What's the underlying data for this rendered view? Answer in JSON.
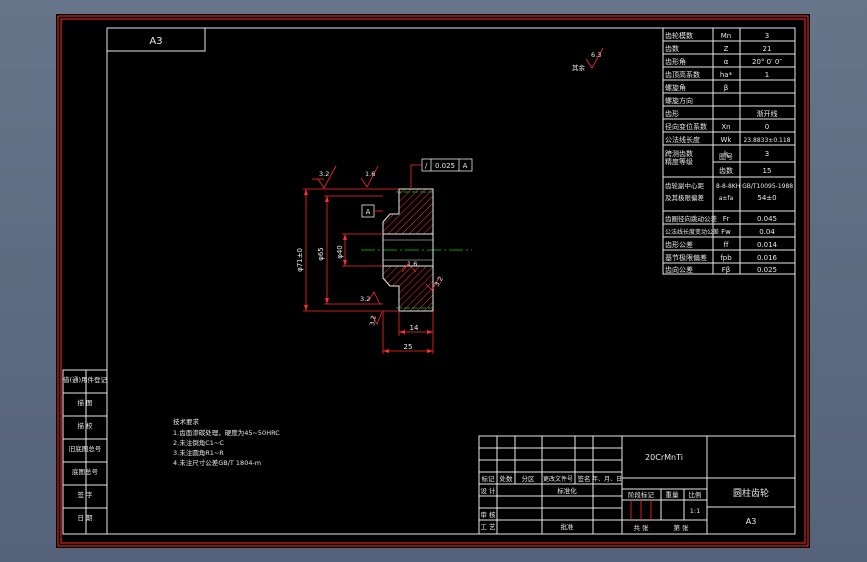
{
  "sheet": {
    "size_label": "A3"
  },
  "params": {
    "rows": [
      {
        "name": "齿轮模数",
        "sym": "Mn",
        "val": "3"
      },
      {
        "name": "齿数",
        "sym": "Z",
        "val": "21"
      },
      {
        "name": "齿形角",
        "sym": "α",
        "val": "20° 0′ 0″"
      },
      {
        "name": "齿顶高系数",
        "sym": "ha*",
        "val": "1"
      },
      {
        "name": "螺旋角",
        "sym": "β",
        "val": ""
      },
      {
        "name": "螺旋方向",
        "sym": "",
        "val": ""
      },
      {
        "name": "齿形",
        "sym": "",
        "val": "渐开线"
      },
      {
        "name": "径向变位系数",
        "sym": "Xn",
        "val": "0"
      },
      {
        "name": "公法线长度",
        "sym": "Wk",
        "val": "23.8833±0.118"
      },
      {
        "name": "跨测齿数",
        "sym": "k",
        "val": "3"
      },
      {
        "name": "精度等级",
        "sym": "",
        "val": ""
      },
      {
        "name": "齿轮副中心距",
        "sym": "",
        "val": ""
      },
      {
        "name": "齿圈径向跳动公差",
        "sym": "Fr",
        "val": "0.045"
      },
      {
        "name": "公法线长度变动公差",
        "sym": "Fw",
        "val": "0.04"
      },
      {
        "name": "齿形公差",
        "sym": "ff",
        "val": "0.014"
      },
      {
        "name": "基节极限偏差",
        "sym": "fpb",
        "val": "0.016"
      },
      {
        "name": "齿向公差",
        "sym": "Fβ",
        "val": "0.025"
      }
    ],
    "precision_sub1": "图号",
    "precision_sub2": "齿数",
    "precision_sub2_val": "15",
    "precision_line": "8-8-8KH GB/T10095-1988",
    "center_dist_line2": "及其极限偏差",
    "center_dist_sym": "a±fa",
    "center_dist_val": "54±0"
  },
  "views": {
    "flatness_tol": "0.025",
    "datum": "A",
    "rough_top_left": "3.2",
    "rough_top_mid": "1.6",
    "rough_bore": "1.6",
    "rough_left_low": "3.2",
    "rough_bottom": "3.2",
    "rough_right_low": "3.2",
    "dia_outer": "φ71±0",
    "dia_hub": "φ65",
    "dia_bore": "φ40",
    "len_step": "14",
    "len_total": "25",
    "rough_other": "6.3",
    "rough_other_label": "其余"
  },
  "notes": {
    "title": "技术要求",
    "lines": [
      "1.齿面渗碳处理，硬度为45~50HRC",
      "2.未注倒角C1~C",
      "3.未注圆角R1~R",
      "4.未注尺寸公差GB/T 1804-m"
    ]
  },
  "left_strip": [
    "借(通)用件登记",
    "描  图",
    "描  校",
    "旧底图总号",
    "底图总号",
    "签  字",
    "日  期"
  ],
  "title_block": {
    "material": "20CrMnTi",
    "part_name": "圆柱齿轮",
    "sheet_size": "A3",
    "revision_headers": [
      "标记",
      "处数",
      "分区",
      "更改文件号",
      "签名",
      "年、月、日"
    ],
    "designer": "设 计",
    "standardization": "标准化",
    "reviewer": "审 核",
    "process": "工 艺",
    "approve": "批准",
    "stage_label": "阶段标记",
    "weight_label": "重量",
    "scale_label": "比例",
    "scale_value": "1:1",
    "sheets_total": "共  张",
    "sheet_no": "第  张"
  }
}
